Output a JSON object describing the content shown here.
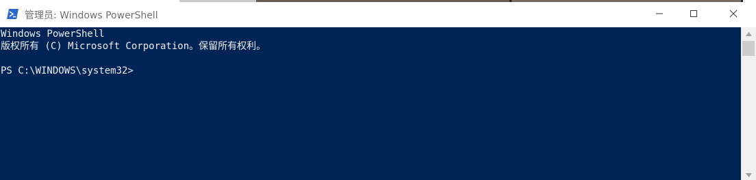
{
  "window": {
    "title": "管理员: Windows PowerShell",
    "icon": "powershell-icon",
    "controls": {
      "minimize": "minimize-icon",
      "maximize": "maximize-icon",
      "close": "close-icon"
    }
  },
  "console": {
    "background": "#012456",
    "foreground": "#eeedf0",
    "lines": [
      "Windows PowerShell",
      "版权所有 (C) Microsoft Corporation。保留所有权利。",
      "PS C:\\WINDOWS\\system32>"
    ]
  },
  "scrollbar": {
    "up_icon": "scroll-up-arrow-icon",
    "down_icon": "scroll-down-arrow-icon"
  }
}
